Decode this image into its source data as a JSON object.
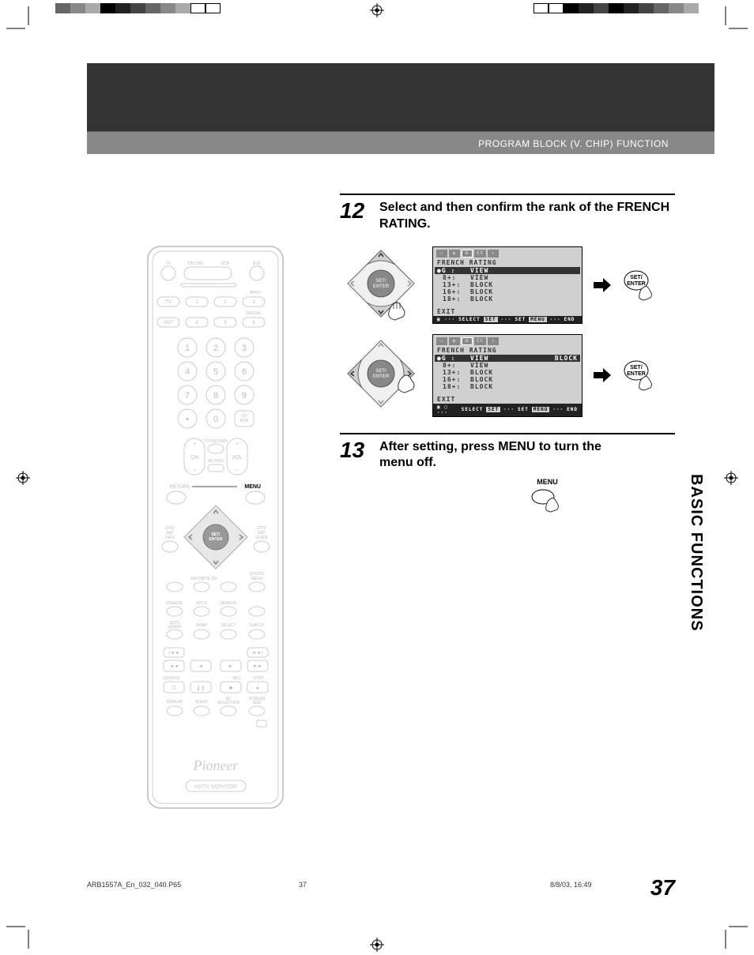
{
  "header": {
    "section": "PROGRAM BLOCK (V. CHIP) FUNCTION"
  },
  "sideTab": "BASIC FUNCTIONS",
  "pageNumber": "37",
  "step12": {
    "num": "12",
    "text": "Select and then confirm the rank of the FRENCH RATING."
  },
  "step13": {
    "num": "13",
    "text": "After setting, press MENU to turn the menu off.",
    "menuLabel": "MENU"
  },
  "osd1": {
    "title": "FRENCH RATING",
    "rows": [
      {
        "k": "G :",
        "v": "VIEW",
        "sel": true
      },
      {
        "k": "8+:",
        "v": "VIEW"
      },
      {
        "k": "13+:",
        "v": "BLOCK"
      },
      {
        "k": "16+:",
        "v": "BLOCK"
      },
      {
        "k": "18+:",
        "v": "BLOCK"
      }
    ],
    "exit": "EXIT",
    "bottom": {
      "select": "SELECT",
      "set": "SET",
      "end": "END",
      "chipSet": "SET",
      "chipMenu": "MENU"
    }
  },
  "osd2": {
    "title": "FRENCH RATING",
    "rows": [
      {
        "k": "G :",
        "v": "VIEW",
        "extra": "BLOCK",
        "sel": true
      },
      {
        "k": "8+:",
        "v": "VIEW"
      },
      {
        "k": "13+:",
        "v": "BLOCK"
      },
      {
        "k": "16+:",
        "v": "BLOCK"
      },
      {
        "k": "18+:",
        "v": "BLOCK"
      }
    ],
    "exit": "EXIT",
    "bottom": {
      "select": "SELECT",
      "set": "SET",
      "end": "END",
      "chipSet": "SET",
      "chipMenu": "MENU"
    }
  },
  "setEnterBtn": "SET/\nENTER",
  "dpadCenter": "SET/\nENTER",
  "remote": {
    "brand": "Pioneer",
    "model": "HDTV MONITOR",
    "topRow": {
      "tv": "TV",
      "cbl": "CBL/SAT",
      "vcr": "VCR",
      "dvd": "DVD /DVR"
    },
    "inputLabel": "INPUT",
    "inputRow1": {
      "tv": "TV",
      "b1": "1",
      "b2": "2",
      "b3": "3"
    },
    "digitalLabel": "DIGITAL",
    "inputRow2": {
      "ant": "ANT",
      "b4": "4",
      "b5": "5",
      "b6": "6"
    },
    "numpad": [
      "1",
      "2",
      "3",
      "4",
      "5",
      "6",
      "7",
      "8",
      "9",
      ".",
      "0"
    ],
    "chNtr": "CH NTR",
    "chReturn": "CH RETURN",
    "ch": "CH",
    "vol": "VOL",
    "muting": "MUTING",
    "return": "RETURN",
    "menu": "MENU",
    "dtvInfo": "DTV/\nSAT\nINFO",
    "dtvGuide": "DTV/\nSAT\nGUIDE",
    "favorite": "FAVORITE CH",
    "sysMenu": "SYSTD/\nMENU",
    "freeze": "FREEZE",
    "split": "SPLIT",
    "search": "SEARCH",
    "edit": "EDIT/\nLEARN",
    "swap": "SWAP",
    "select": "SELECT",
    "subch": "SUB CH",
    "source": "SOURCE",
    "rec": "REC",
    "stop": "STOP",
    "display": "DISPLAY",
    "sleep": "SLEEP",
    "avsel": "AV\nSELECTION",
    "screen": "SCREEN\nSIZE"
  },
  "footer": {
    "file": "ARB1557A_En_032_040.P65",
    "page": "37",
    "date": "8/8/03, 16:49"
  }
}
